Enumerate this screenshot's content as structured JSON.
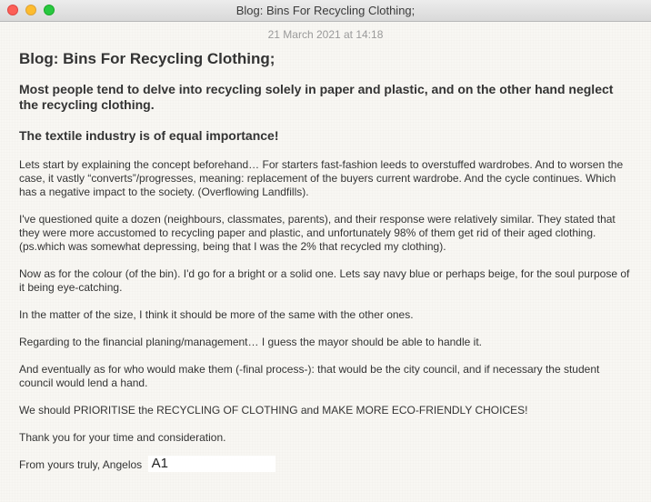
{
  "window": {
    "title": "Blog: Bins For Recycling Clothing;"
  },
  "note": {
    "date": "21 March 2021 at 14:18",
    "title": "Blog: Bins For Recycling Clothing;",
    "lead": "Most people tend to delve into recycling solely in paper and plastic, and on the other hand neglect the recycling clothing.",
    "subheading": "The textile industry is of equal importance!",
    "paragraphs": [
      "Lets start by explaining the concept beforehand… For starters fast-fashion leeds to overstuffed wardrobes. And to worsen the case, it vastly “converts”/progresses, meaning: replacement of the buyers current wardrobe. And the cycle continues. Which has a negative impact to the society. (Overflowing Landfills).",
      "I've questioned quite a dozen (neighbours, classmates, parents), and their response were relatively similar. They stated that they were more accustomed to recycling paper and plastic, and unfortunately 98% of them get rid of their aged clothing. (ps.which was somewhat depressing, being that I was the 2% that recycled my clothing).",
      "Now as for the colour (of the bin). I'd go for a bright or a solid one. Lets say navy blue or perhaps beige, for the soul purpose of it being eye-catching.",
      "In the matter of the size, I think it should be more of the same with the other ones.",
      "Regarding to the financial planing/management… I guess the mayor should be able to handle it.",
      "And eventually as for who would make them (-final process-): that would be the city council, and if necessary the student council would lend a hand.",
      "We should PRIORITISE the RECYCLING OF CLOTHING and MAKE MORE ECO-FRIENDLY CHOICES!",
      "Thank you for your time and consideration."
    ],
    "signoff": "From yours truly, Angelos",
    "signature_mark": "A1"
  }
}
